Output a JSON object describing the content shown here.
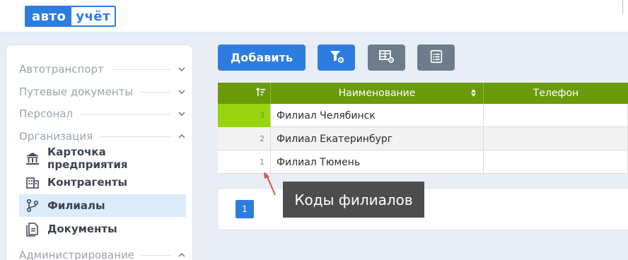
{
  "header": {
    "logo_left": "авто",
    "logo_right": "учёт"
  },
  "sidebar": {
    "sections": [
      {
        "label": "Автотранспорт",
        "state": "collapsed"
      },
      {
        "label": "Путевые документы",
        "state": "collapsed"
      },
      {
        "label": "Персонал",
        "state": "collapsed"
      },
      {
        "label": "Организация",
        "state": "expanded"
      },
      {
        "label": "Администрирование",
        "state": "expanded"
      }
    ],
    "items": [
      {
        "label": "Карточка предприятия",
        "icon": "bank-icon"
      },
      {
        "label": "Контрагенты",
        "icon": "building-icon"
      },
      {
        "label": "Филиалы",
        "icon": "branch-icon",
        "active": true
      },
      {
        "label": "Документы",
        "icon": "document-icon"
      }
    ]
  },
  "toolbar": {
    "add_label": "Добавить",
    "filter_icon": "filter-settings-icon",
    "grid_icon": "table-settings-icon",
    "list_icon": "list-icon"
  },
  "table": {
    "columns": [
      "",
      "Наименование",
      "Телефон"
    ],
    "rows": [
      {
        "num": "3",
        "name": "Филиал Челябинск",
        "phone": ""
      },
      {
        "num": "2",
        "name": "Филиал Екатеринбург",
        "phone": ""
      },
      {
        "num": "1",
        "name": "Филиал Тюмень",
        "phone": ""
      }
    ]
  },
  "pagination": {
    "current_page": "1"
  },
  "annotation": {
    "text": "Коды филиалов"
  },
  "colors": {
    "brand_blue": "#2d7de0",
    "header_green": "#6a9a08",
    "highlight_green": "#97d40f",
    "gray_button": "#6d7c8d",
    "callout_bg": "#4d4d4d",
    "arrow_red": "#d9534f"
  }
}
